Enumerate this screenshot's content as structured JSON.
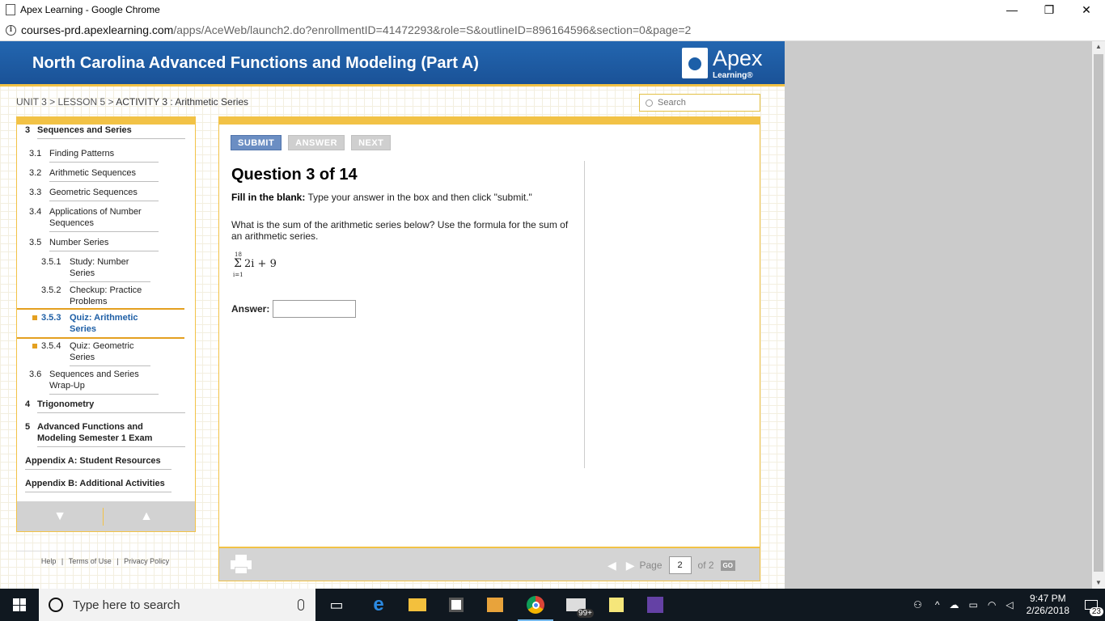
{
  "window": {
    "title": "Apex Learning - Google Chrome",
    "minimize": "—",
    "restore": "❐",
    "close": "✕"
  },
  "address": {
    "host": "courses-prd.apexlearning.com",
    "path": "/apps/AceWeb/launch2.do?enrollmentID=41472293&role=S&outlineID=896164596&section=0&page=2"
  },
  "header": {
    "course_title": "North Carolina Advanced Functions and Modeling (Part A)",
    "logo_brand": "Apex",
    "logo_sub": "Learning®"
  },
  "breadcrumb": {
    "unit": "UNIT 3",
    "sep1": " > ",
    "lesson": "LESSON 5",
    "sep2": " > ",
    "current": "ACTIVITY 3 : Arithmetic Series"
  },
  "search": {
    "placeholder": "Search"
  },
  "sidebar": {
    "items": [
      {
        "num": "3",
        "label": "Sequences and Series"
      },
      {
        "num": "3.1",
        "label": "Finding Patterns"
      },
      {
        "num": "3.2",
        "label": "Arithmetic Sequences"
      },
      {
        "num": "3.3",
        "label": "Geometric Sequences"
      },
      {
        "num": "3.4",
        "label": "Applications of Number Sequences"
      },
      {
        "num": "3.5",
        "label": "Number Series"
      },
      {
        "num": "3.5.1",
        "label": "Study: Number Series"
      },
      {
        "num": "3.5.2",
        "label": "Checkup: Practice Problems"
      },
      {
        "num": "3.5.3",
        "label": "Quiz: Arithmetic Series"
      },
      {
        "num": "3.5.4",
        "label": "Quiz: Geometric Series"
      },
      {
        "num": "3.6",
        "label": "Sequences and Series Wrap-Up"
      },
      {
        "num": "4",
        "label": "Trigonometry"
      },
      {
        "num": "5",
        "label": "Advanced Functions and Modeling Semester 1 Exam"
      },
      {
        "num": "",
        "label": "Appendix A: Student Resources"
      },
      {
        "num": "",
        "label": "Appendix B: Additional Activities"
      }
    ],
    "down": "▼",
    "up": "▲"
  },
  "footer": {
    "help": "Help",
    "sep": "|",
    "terms": "Terms of Use",
    "privacy": "Privacy Policy"
  },
  "question": {
    "submit": "SUBMIT",
    "answer": "ANSWER",
    "next": "NEXT",
    "title": "Question 3 of 14",
    "instr_bold": "Fill in the blank:",
    "instr_text": " Type your answer in the box and then click \"submit.\"",
    "prompt": "What is the sum of the arithmetic series below? Use the formula for the sum of an arithmetic series.",
    "formula_upper": "18",
    "formula_sigma": "Σ",
    "formula_lower": "i=1",
    "formula_expr": "2i + 9",
    "answer_label": "Answer:",
    "answer_value": ""
  },
  "pager": {
    "prev": "◀",
    "next": "▶",
    "page_label": "Page",
    "page_value": "2",
    "of_label": "of 2",
    "go": "GO"
  },
  "taskbar": {
    "search_text": "Type here to search",
    "time": "9:47 PM",
    "date": "2/26/2018",
    "notif": "23",
    "badge": "99+"
  }
}
